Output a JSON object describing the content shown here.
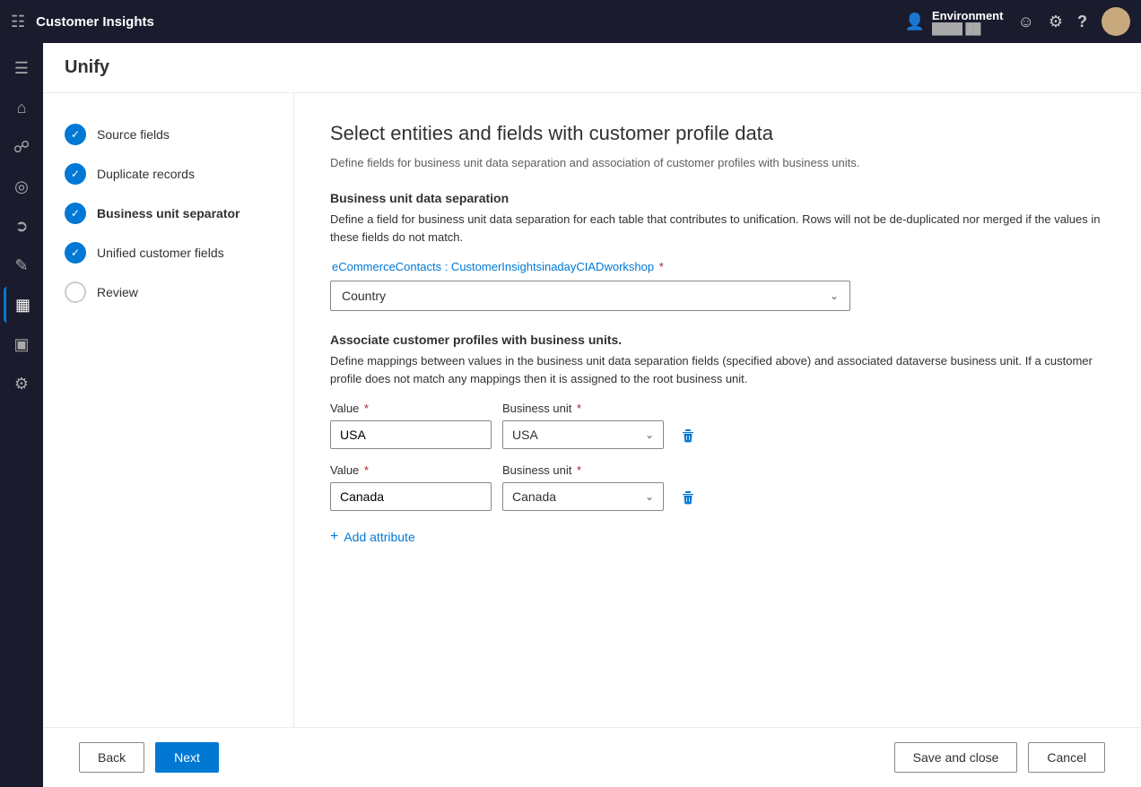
{
  "app": {
    "title": "Customer Insights"
  },
  "topbar": {
    "env_label": "Environment",
    "env_sub": "████ ██"
  },
  "page_header": {
    "title": "Unify"
  },
  "steps": [
    {
      "id": "source-fields",
      "label": "Source fields",
      "state": "completed",
      "bold": false
    },
    {
      "id": "duplicate-records",
      "label": "Duplicate records",
      "state": "completed",
      "bold": false
    },
    {
      "id": "business-unit-separator",
      "label": "Business unit separator",
      "state": "completed",
      "bold": true
    },
    {
      "id": "unified-customer-fields",
      "label": "Unified customer fields",
      "state": "completed",
      "bold": false
    },
    {
      "id": "review",
      "label": "Review",
      "state": "empty",
      "bold": false
    }
  ],
  "main": {
    "page_title": "Select entities and fields with customer profile data",
    "page_desc": "Define fields for business unit data separation and association of customer profiles with business units.",
    "section1": {
      "title": "Business unit data separation",
      "desc": "Define a field for business unit data separation for each table that contributes to unification. Rows will not be de-duplicated nor merged if the values in these fields do not match.",
      "field_label_prefix": "eCommerceContacts : CustomerInsightsinadayCIADworkshop",
      "field_label_required": true,
      "dropdown_value": "Country",
      "dropdown_placeholder": "Country"
    },
    "section2": {
      "title": "Associate customer profiles with business units.",
      "desc": "Define mappings between values in the business unit data separation fields (specified above) and associated dataverse business unit. If a customer profile does not match any mappings then it is assigned to the root business unit.",
      "rows": [
        {
          "value": "USA",
          "business_unit": "USA"
        },
        {
          "value": "Canada",
          "business_unit": "Canada"
        }
      ],
      "value_label": "Value",
      "business_unit_label": "Business unit",
      "add_attr_label": "Add attribute"
    }
  },
  "footer": {
    "back_label": "Back",
    "next_label": "Next",
    "save_close_label": "Save and close",
    "cancel_label": "Cancel"
  },
  "icons": {
    "grid": "⊞",
    "home": "⌂",
    "analytics": "📊",
    "target": "◎",
    "chart": "📈",
    "lightbulb": "💡",
    "segments": "⊡",
    "reports": "📋",
    "settings": "⚙",
    "chevron_down": "∨",
    "trash": "🗑",
    "plus": "+",
    "check": "✓",
    "user": "👤",
    "smiley": "☺",
    "gear": "⚙",
    "question": "?",
    "bell": "🔔"
  }
}
